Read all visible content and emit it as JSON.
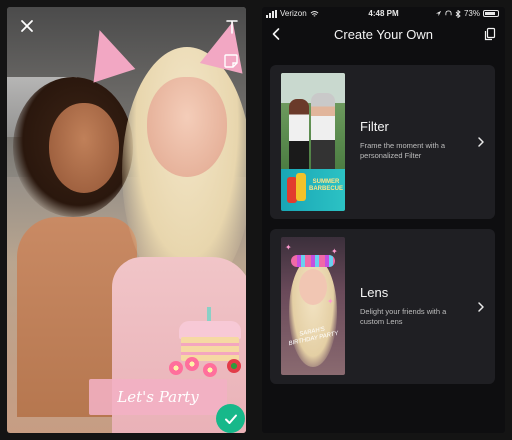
{
  "left_screen": {
    "banner_text": "Let's Party",
    "confirm_color": "#17b88a",
    "icons": [
      "close-icon",
      "text-tool-icon",
      "sticker-icon",
      "checkmark-icon"
    ]
  },
  "right_screen": {
    "status_bar": {
      "carrier": "Verizon",
      "time": "4:48 PM",
      "battery": "73%"
    },
    "header": {
      "title": "Create Your Own"
    },
    "options": [
      {
        "title": "Filter",
        "description": "Frame the moment with a personalized Filter",
        "thumbnail_text": "SUMMER BARBECUE"
      },
      {
        "title": "Lens",
        "description": "Delight your friends with a custom Lens",
        "thumbnail_text": "SARAH'S BIRTHDAY PARTY"
      }
    ]
  }
}
